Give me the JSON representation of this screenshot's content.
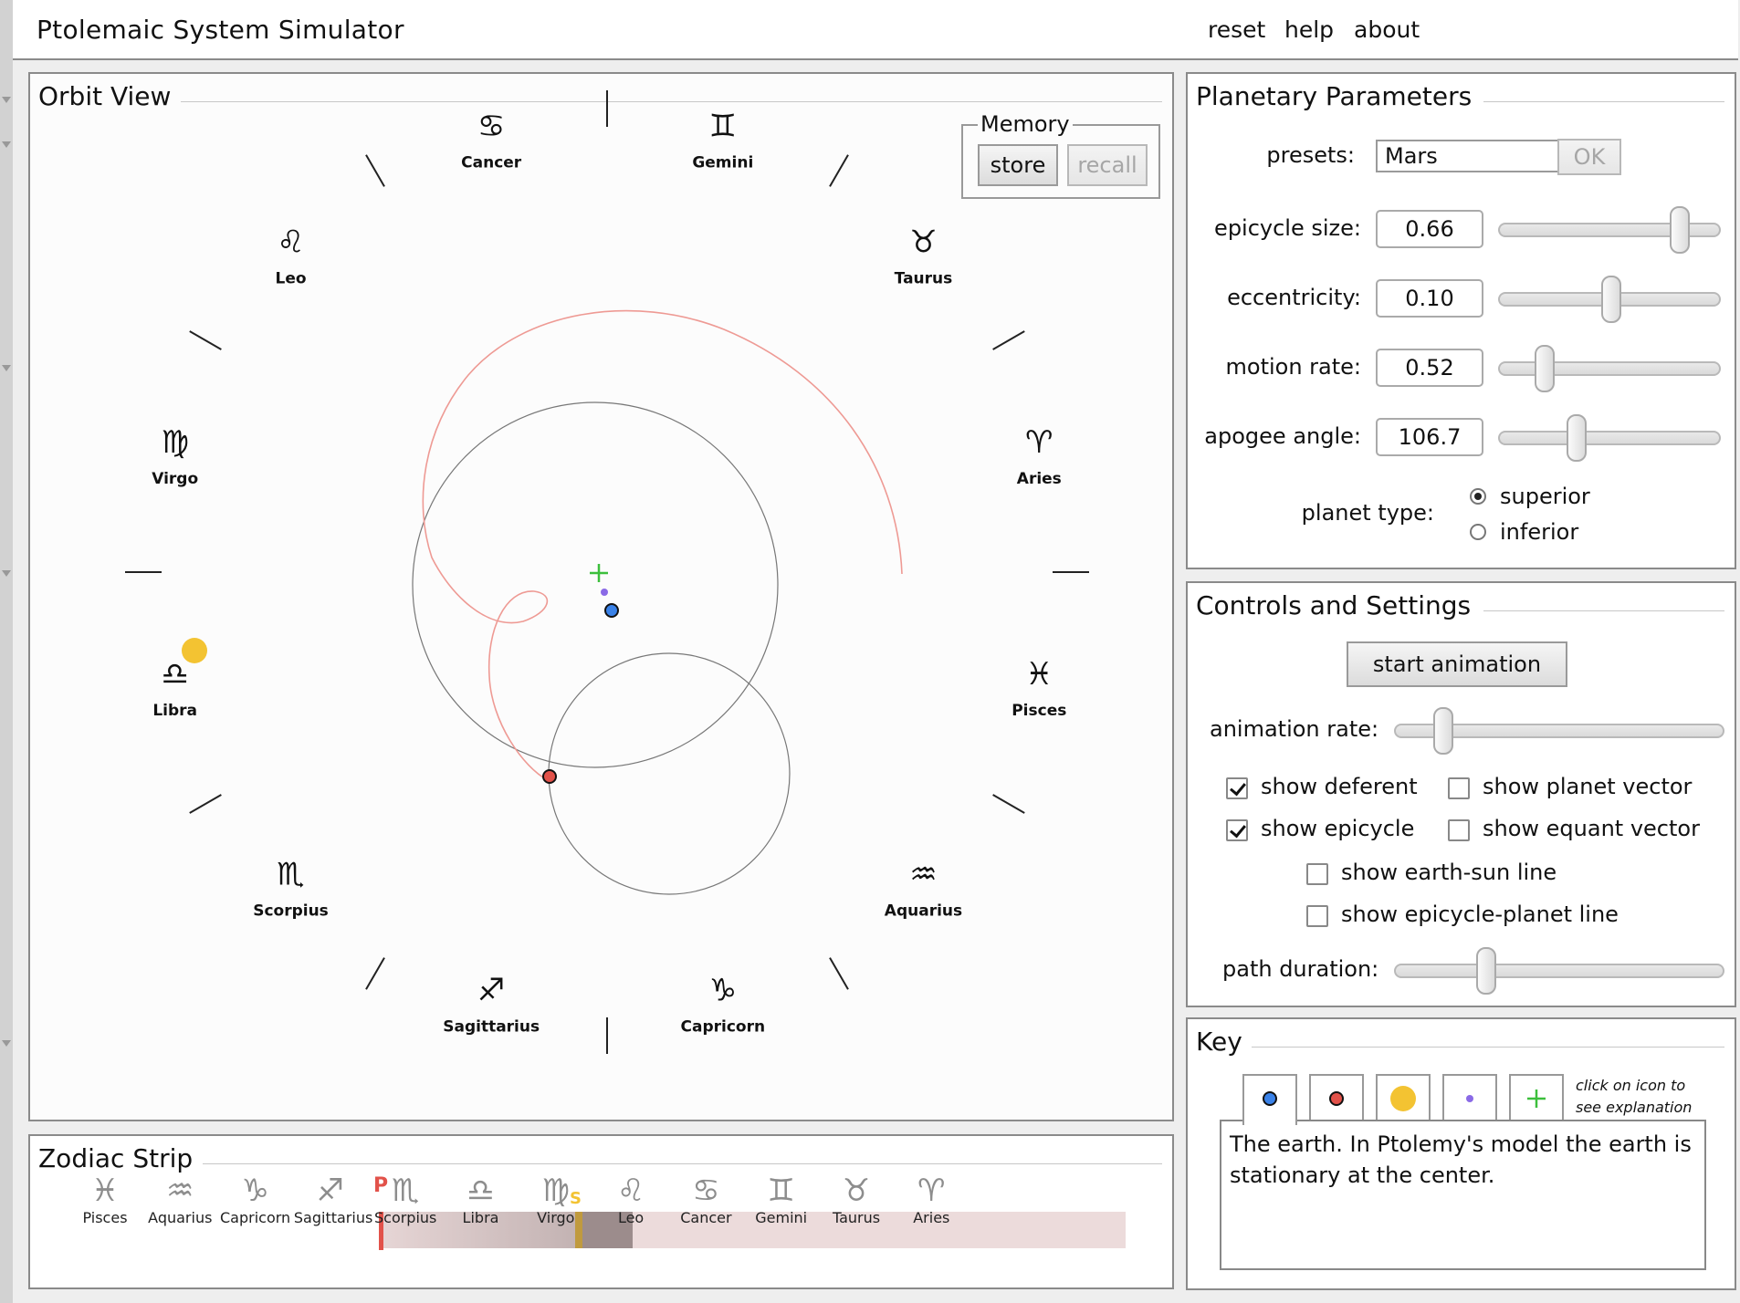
{
  "app": {
    "title": "Ptolemaic System Simulator"
  },
  "menu": {
    "reset": "reset",
    "help": "help",
    "about": "about"
  },
  "orbit_view": {
    "title": "Orbit View",
    "memory": {
      "legend": "Memory",
      "store": "store",
      "recall": "recall"
    },
    "zodiac": [
      {
        "name": "Cancer",
        "glyph": "♋"
      },
      {
        "name": "Gemini",
        "glyph": "♊"
      },
      {
        "name": "Taurus",
        "glyph": "♉"
      },
      {
        "name": "Aries",
        "glyph": "♈"
      },
      {
        "name": "Pisces",
        "glyph": "♓"
      },
      {
        "name": "Aquarius",
        "glyph": "♒"
      },
      {
        "name": "Capricorn",
        "glyph": "♑"
      },
      {
        "name": "Sagittarius",
        "glyph": "♐"
      },
      {
        "name": "Scorpius",
        "glyph": "♏"
      },
      {
        "name": "Libra",
        "glyph": "♎"
      },
      {
        "name": "Virgo",
        "glyph": "♍"
      },
      {
        "name": "Leo",
        "glyph": "♌"
      }
    ]
  },
  "zodiac_strip": {
    "title": "Zodiac Strip",
    "planet_marker": "P",
    "sun_marker": "S",
    "signs": [
      {
        "name": "Pisces",
        "glyph": "♓"
      },
      {
        "name": "Aquarius",
        "glyph": "♒"
      },
      {
        "name": "Capricorn",
        "glyph": "♑"
      },
      {
        "name": "Sagittarius",
        "glyph": "♐"
      },
      {
        "name": "Scorpius",
        "glyph": "♏"
      },
      {
        "name": "Libra",
        "glyph": "♎"
      },
      {
        "name": "Virgo",
        "glyph": "♍"
      },
      {
        "name": "Leo",
        "glyph": "♌"
      },
      {
        "name": "Cancer",
        "glyph": "♋"
      },
      {
        "name": "Gemini",
        "glyph": "♊"
      },
      {
        "name": "Taurus",
        "glyph": "♉"
      },
      {
        "name": "Aries",
        "glyph": "♈"
      }
    ]
  },
  "params": {
    "title": "Planetary Parameters",
    "presets_label": "presets:",
    "preset_value": "Mars",
    "ok": "OK",
    "epicycle_size_label": "epicycle size:",
    "epicycle_size": "0.66",
    "epicycle_size_level": 0.84,
    "eccentricity_label": "eccentricity:",
    "eccentricity": "0.10",
    "eccentricity_level": 0.5,
    "motion_rate_label": "motion rate:",
    "motion_rate": "0.52",
    "motion_rate_level": 0.17,
    "apogee_angle_label": "apogee angle:",
    "apogee_angle": "106.7",
    "apogee_angle_level": 0.33,
    "planet_type_label": "planet type:",
    "superior": "superior",
    "inferior": "inferior"
  },
  "controls": {
    "title": "Controls and Settings",
    "start_animation": "start animation",
    "animation_rate_label": "animation rate:",
    "animation_rate_level": 0.12,
    "show_deferent": "show deferent",
    "show_planet_vector": "show planet vector",
    "show_epicycle": "show epicycle",
    "show_equant_vector": "show equant vector",
    "show_earth_sun_line": "show earth-sun line",
    "show_epicycle_planet_line": "show epicycle-planet line",
    "path_duration_label": "path duration:",
    "path_duration_level": 0.26
  },
  "key": {
    "title": "Key",
    "hint": "click on icon to see explanation",
    "explanation": "The earth. In Ptolemy's model the earth is stationary at the center."
  },
  "colors": {
    "earth": "#3a82e8",
    "planet": "#e2524a",
    "sun": "#f3c332",
    "equant": "#8a6ae6",
    "center": "#3cbf3c",
    "path": "#ee9a94"
  }
}
